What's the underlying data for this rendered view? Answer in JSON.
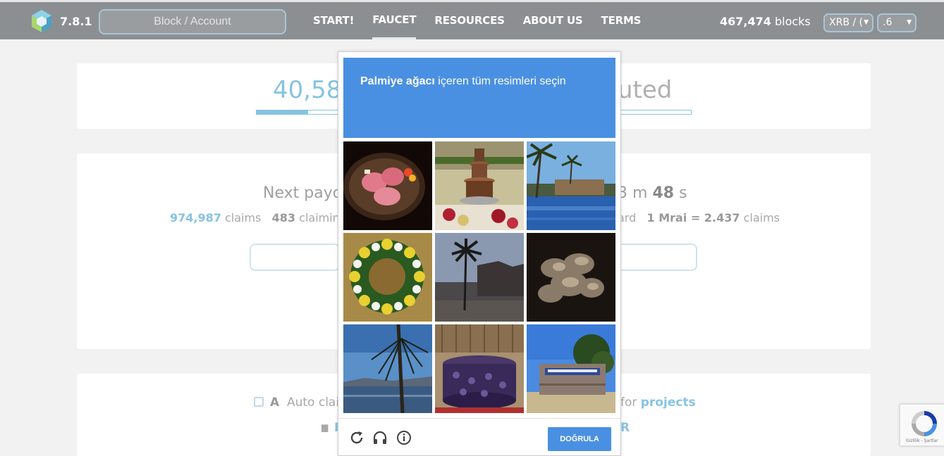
{
  "topbar": {
    "version": "7.8.1",
    "search_placeholder": "Block / Account",
    "nav": [
      "START!",
      "FAUCET",
      "RESOURCES",
      "ABOUT US",
      "TERMS"
    ],
    "active_nav": "FAUCET",
    "blocks_count": "467,474",
    "blocks_label": "blocks",
    "currency_select": "XRB / (",
    "decimal_select": ".6"
  },
  "distribution": {
    "amount": "40,580",
    "suffix": "uted",
    "progress_fraction": 0.12
  },
  "payout": {
    "label": "Next payo",
    "timer_min": "3",
    "timer_min_unit": "m",
    "timer_sec": "48",
    "timer_sec_unit": "s",
    "claims_count": "974,987",
    "claims_label": "claims",
    "claiming_count": "483",
    "claiming_label": "claimin",
    "reward_label": "ard",
    "rate": "1 Mrai = 2.437",
    "rate_label": "claims"
  },
  "options": {
    "auto_letter": "A",
    "auto_label": "Auto clai",
    "for_label": "for",
    "projects_link": "projects",
    "r_text": "R"
  },
  "captcha": {
    "title_bold": "Palmiye ağacı",
    "title_rest": " içeren tüm resimleri seçin",
    "verify_label": "DOĞRULA",
    "tiles": [
      "meat-plate",
      "chocolate-fountain",
      "palm-pool",
      "flower-wreath",
      "palm-ruins",
      "dried-flowers",
      "palm-lake",
      "cake",
      "sign-wall"
    ]
  },
  "recaptcha": {
    "text": "Gizlilik - Şartlar"
  },
  "colors": {
    "accent": "#86c3e2",
    "captcha_blue": "#4a90e2",
    "topbar": "#8c8f92"
  }
}
